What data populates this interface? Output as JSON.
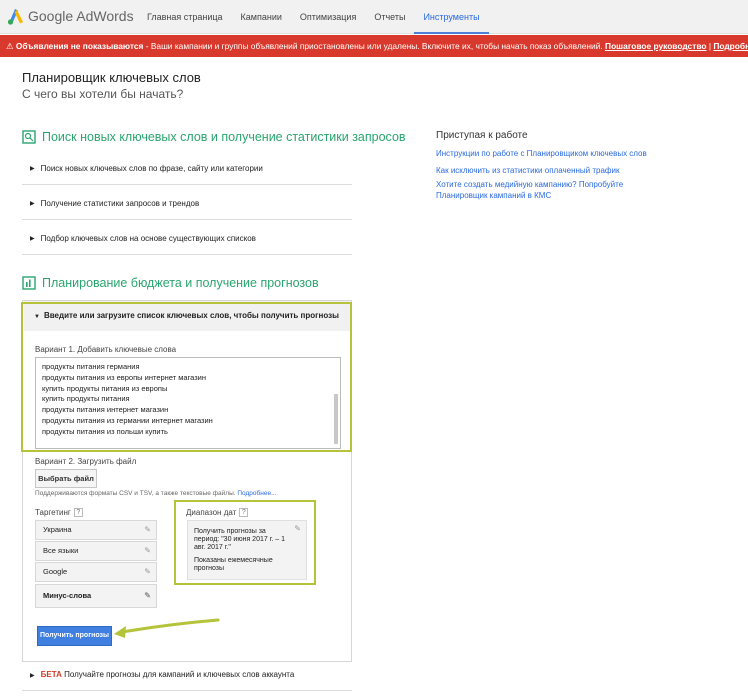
{
  "header": {
    "brand": "Google AdWords",
    "nav": [
      "Главная страница",
      "Кампании",
      "Оптимизация",
      "Отчеты",
      "Инструменты"
    ],
    "active_index": 4
  },
  "alert": {
    "bold_text": "Объявления не показываются",
    "text": " - Ваши кампании и группы объявлений приостановлены или удалены. Включите их, чтобы начать показ объявлений.",
    "guide_link": "Пошаговое руководство",
    "separator": "|",
    "more_link": "Подробнее..."
  },
  "page": {
    "title": "Планировщик ключевых слов",
    "subtitle": "С чего вы хотели бы начать?"
  },
  "search_section": {
    "title": "Поиск новых ключевых слов и получение статистики запросов",
    "items": [
      "Поиск новых ключевых слов по фразе, сайту или категории",
      "Получение статистики запросов и трендов",
      "Подбор ключевых слов на основе существующих списков"
    ]
  },
  "sidebar": {
    "title": "Приступая к работе",
    "links": [
      "Инструкции по работе с Планировщиком ключевых слов",
      "Как исключить из статистики оплаченный трафик",
      "Хотите создать медийную кампанию? Попробуйте Планировщик кампаний в КМС"
    ]
  },
  "budget_section": {
    "title": "Планирование бюджета и получение прогнозов",
    "panel_heading": "Введите или загрузите список ключевых слов, чтобы получить прогнозы",
    "option1_label": "Вариант 1. Добавить ключевые слова",
    "keywords": [
      "продукты питания германия",
      "продукты питания из европы интернет магазин",
      "купить продукты питания из европы",
      "купить продукты питания",
      "продукты питания интернет магазин",
      "продукты питания из германии интернет магазин",
      "продукты питания из польши купить"
    ],
    "option2_label": "Вариант 2. Загрузить файл",
    "choose_file_button": "Выбрать файл",
    "formats_hint": "Поддерживаются форматы CSV и TSV, а также текстовые файлы.",
    "formats_more": "Подробнее...",
    "targeting_label": "Таргетинг",
    "targeting": [
      "Украина",
      "Все языки",
      "Google",
      "Минус-слова"
    ],
    "date_range_label": "Диапазон дат",
    "date_range_text": "Получить прогнозы за период: \"30 июня 2017 г. – 1 авг. 2017 г.\"",
    "date_range_note": "Показаны ежемесячные прогнозы",
    "forecast_button": "Получить прогнозы"
  },
  "beta_row": {
    "badge": "БЕТА",
    "text": "Получайте прогнозы для кампаний и ключевых слов аккаунта"
  },
  "colors": {
    "green": "#2aa56f",
    "highlight": "#b5c33a",
    "alert": "#d9392c",
    "link": "#2a6ae0",
    "button": "#3f7fe0"
  }
}
